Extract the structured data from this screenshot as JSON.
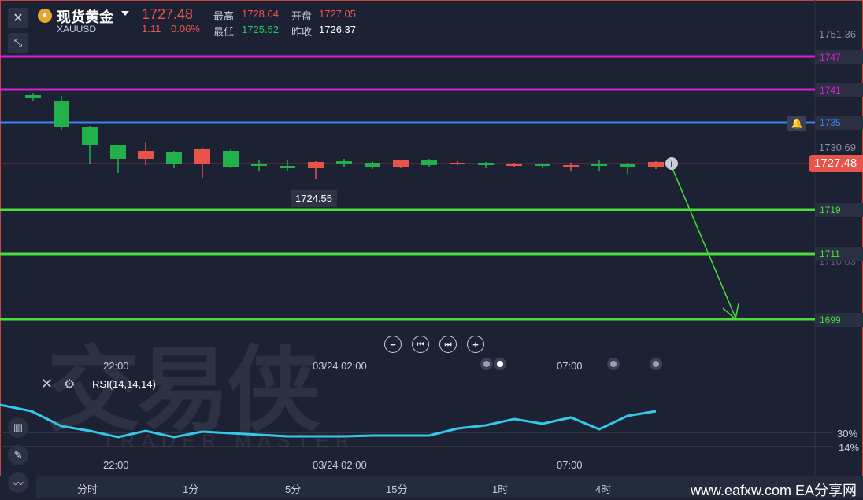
{
  "header": {
    "title": "现货黄金",
    "symbol": "XAUUSD",
    "price": "1727.48",
    "change": "1.11",
    "change_pct": "0.06%",
    "high_label": "最高",
    "high": "1728.04",
    "open_label": "开盘",
    "open": "1727.05",
    "low_label": "最低",
    "low": "1725.52",
    "prev_label": "昨收",
    "prev": "1726.37"
  },
  "axis_labels": {
    "top": "1751.36",
    "mid": "1730.69",
    "faded": "1710.03"
  },
  "levels": [
    {
      "value": "1747",
      "color": "#d81fd8"
    },
    {
      "value": "1741",
      "color": "#d81fd8"
    },
    {
      "value": "1735",
      "color": "#3b82f6"
    },
    {
      "value": "1719",
      "color": "#4ade3a"
    },
    {
      "value": "1711",
      "color": "#4ade3a"
    },
    {
      "value": "1699",
      "color": "#4ade3a"
    }
  ],
  "current_price_tag": "1727.48",
  "low_marker": "1724.55",
  "time_labels": {
    "t1": "22:00",
    "t2": "03/24 02:00",
    "t3": "07:00"
  },
  "rsi": {
    "label": "RSI(14,14,14)",
    "level_high": "30%",
    "level_low": "14%"
  },
  "tabs": [
    "分时",
    "1分",
    "5分",
    "15分",
    "1时",
    "4时"
  ],
  "watermark": {
    "cn": "交易侠",
    "en": "TRADER MASTER"
  },
  "footer": "www.eafxw.com  EA分享网",
  "colors": {
    "bull": "#22b04b",
    "bear": "#e8534a",
    "rsi": "#35c8e8"
  }
}
